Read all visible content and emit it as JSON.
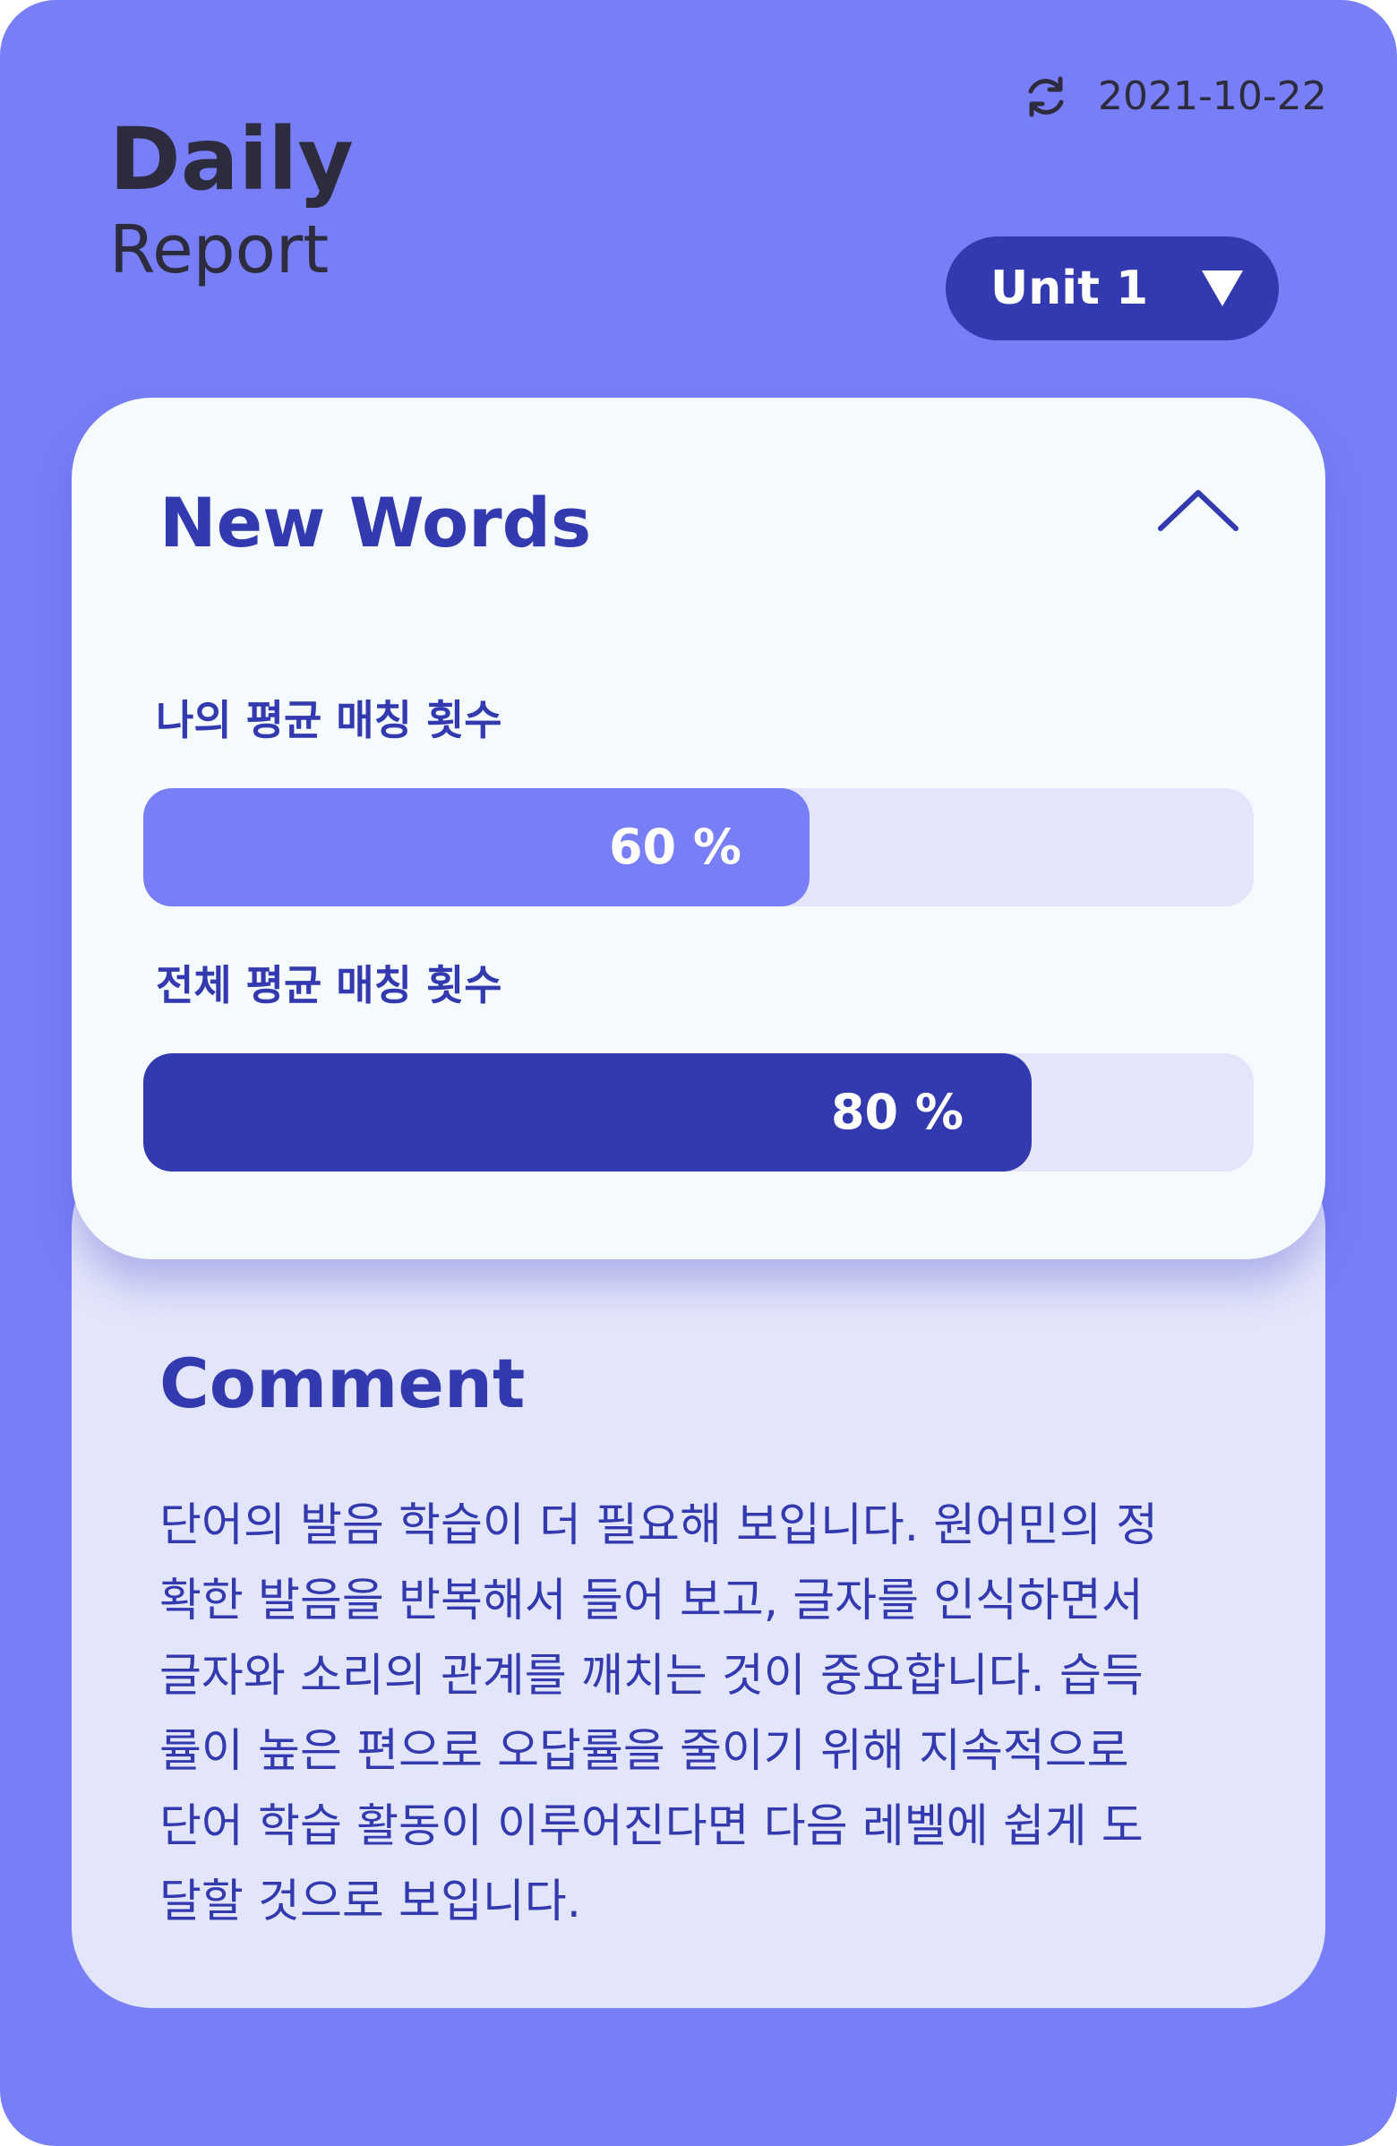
{
  "header": {
    "title": "Daily",
    "subtitle": "Report",
    "date": "2021-10-22",
    "refresh_icon": "refresh-icon",
    "unit_select": {
      "label": "Unit 1",
      "icon": "caret-down-icon"
    }
  },
  "new_words": {
    "heading": "New Words",
    "collapse_icon": "chevron-up-icon",
    "stats": [
      {
        "label": "나의 평균 매칭 횟수",
        "value_text": "60 %",
        "fraction": 0.6,
        "color": "#787ef5"
      },
      {
        "label": "전체 평균 매칭 횟수",
        "value_text": "80 %",
        "fraction": 0.8,
        "color": "#3339ae"
      }
    ]
  },
  "comment": {
    "heading": "Comment",
    "lines": [
      "단어의 발음 학습이 더 필요해 보입니다. 원어민의 정",
      "확한 발음을 반복해서 들어 보고, 글자를 인식하면서",
      "글자와 소리의 관계를 깨치는 것이 중요합니다. 습득",
      "률이 높은 편으로 오답률을 줄이기 위해 지속적으로",
      "단어 학습 활동이 이루어진다면 다음 레벨에 쉽게 도",
      "달할 것으로 보입니다."
    ]
  },
  "colors": {
    "background": "#787ef5",
    "accent_dark": "#3339ae",
    "accent_light": "#787ef5",
    "track": "#e3e5fa",
    "card": "#f5fafd",
    "text_dark": "#2c2c3e"
  }
}
